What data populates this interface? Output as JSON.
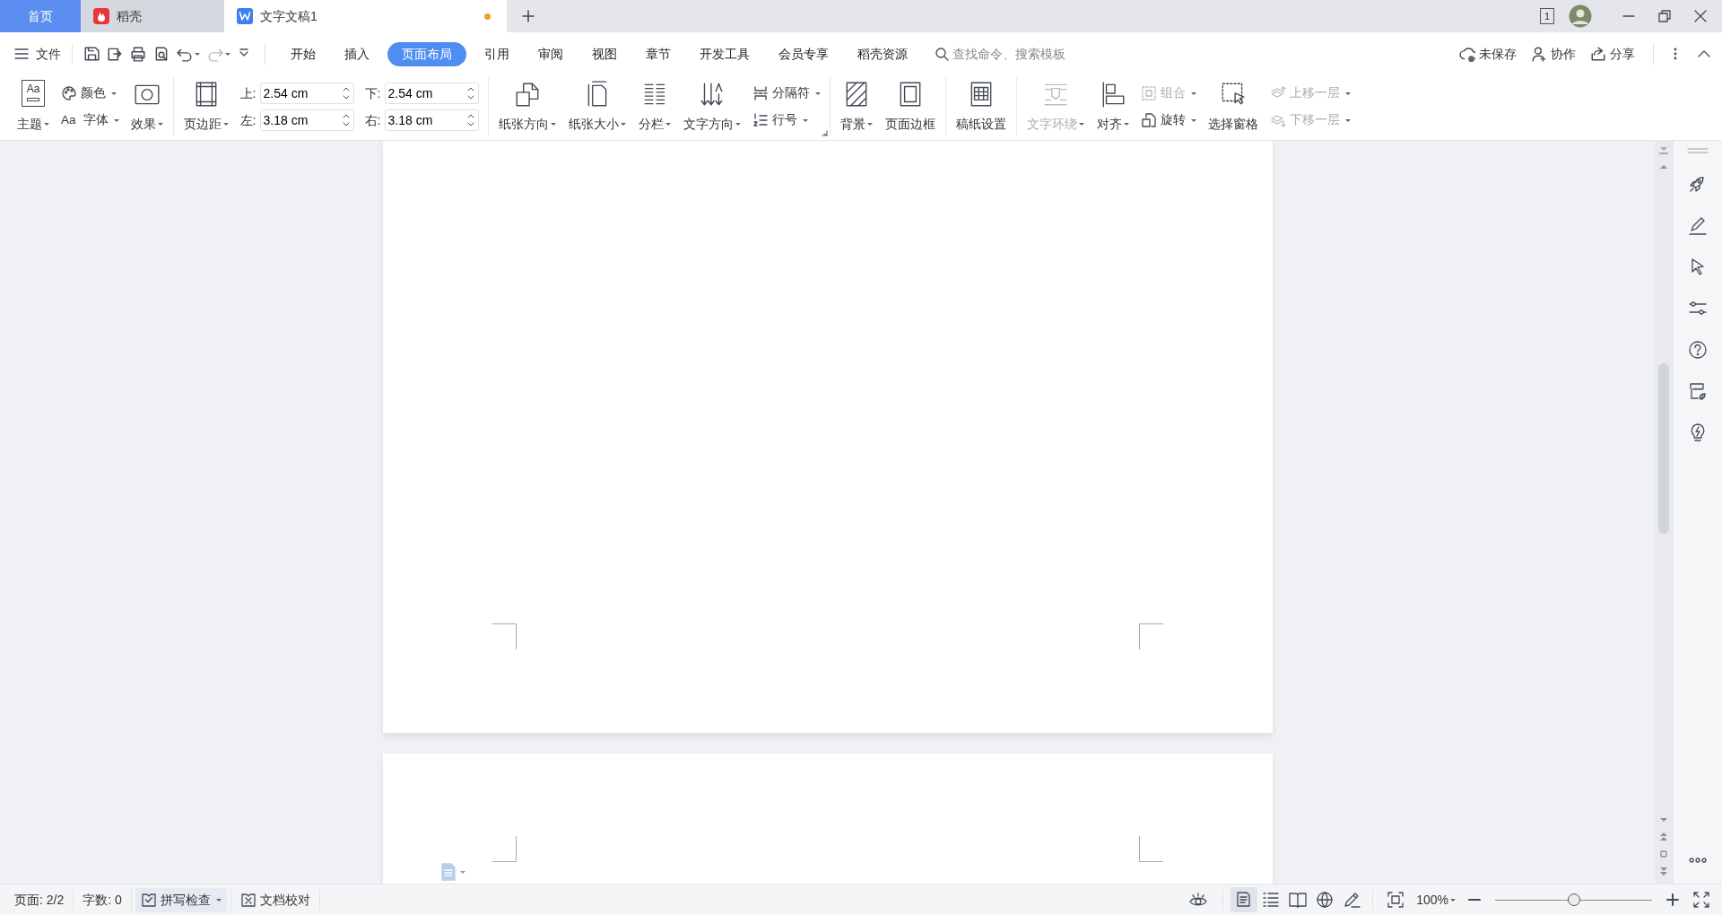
{
  "tabs": [
    {
      "kind": "home",
      "label": "首页",
      "selected": false
    },
    {
      "kind": "app",
      "label": "稻壳",
      "selected": false
    },
    {
      "kind": "document",
      "label": "文字文稿1",
      "selected": true,
      "unsaved": true
    }
  ],
  "title_bar": {
    "screen_badge": "1"
  },
  "menu": {
    "file": "文件",
    "tabs": [
      {
        "label": "开始",
        "selected": false
      },
      {
        "label": "插入",
        "selected": false
      },
      {
        "label": "页面布局",
        "selected": true
      },
      {
        "label": "引用",
        "selected": false
      },
      {
        "label": "审阅",
        "selected": false
      },
      {
        "label": "视图",
        "selected": false
      },
      {
        "label": "章节",
        "selected": false
      },
      {
        "label": "开发工具",
        "selected": false
      },
      {
        "label": "会员专享",
        "selected": false
      },
      {
        "label": "稻壳资源",
        "selected": false
      }
    ],
    "search": {
      "placeholder": "查找命令、搜索模板"
    },
    "actions": [
      {
        "label": "未保存"
      },
      {
        "label": "协作"
      },
      {
        "label": "分享"
      }
    ]
  },
  "ribbon": {
    "groups": [
      {
        "items": [
          {
            "kind": "large",
            "label": "主题",
            "icon_text": "Aa",
            "dropdown": true
          },
          {
            "kind": "stack",
            "items": [
              {
                "label": "颜色",
                "dropdown": true
              },
              {
                "label": "字体",
                "icon_text": "Aa",
                "dropdown": true
              }
            ]
          },
          {
            "kind": "large",
            "label": "效果",
            "dropdown": true
          }
        ]
      },
      {
        "items": [
          {
            "kind": "large",
            "label": "页边距",
            "dropdown": true
          },
          {
            "kind": "fields",
            "fields": [
              {
                "label": "上:",
                "value": "2.54 cm"
              },
              {
                "label": "左:",
                "value": "3.18 cm"
              }
            ]
          },
          {
            "kind": "fields",
            "fields": [
              {
                "label": "下:",
                "value": "2.54 cm"
              },
              {
                "label": "右:",
                "value": "3.18 cm"
              }
            ]
          }
        ]
      },
      {
        "launcher": true,
        "items": [
          {
            "kind": "large",
            "label": "纸张方向",
            "dropdown": true
          },
          {
            "kind": "large",
            "label": "纸张大小",
            "dropdown": true
          },
          {
            "kind": "large",
            "label": "分栏",
            "dropdown": true
          },
          {
            "kind": "large",
            "label": "文字方向",
            "dropdown": true
          },
          {
            "kind": "stack",
            "items": [
              {
                "label": "分隔符",
                "dropdown": true
              },
              {
                "label": "行号",
                "dropdown": true
              }
            ]
          }
        ]
      },
      {
        "items": [
          {
            "kind": "large",
            "label": "背景",
            "dropdown": true
          },
          {
            "kind": "large",
            "label": "页面边框"
          }
        ]
      },
      {
        "items": [
          {
            "kind": "large",
            "label": "稿纸设置"
          }
        ]
      },
      {
        "items": [
          {
            "kind": "large",
            "label": "文字环绕",
            "dropdown": true,
            "disabled": true
          },
          {
            "kind": "large",
            "label": "对齐",
            "dropdown": true
          },
          {
            "kind": "stack",
            "items": [
              {
                "label": "组合",
                "dropdown": true,
                "disabled": true
              },
              {
                "label": "旋转",
                "dropdown": true
              }
            ]
          },
          {
            "kind": "large",
            "label": "选择窗格"
          },
          {
            "kind": "stack",
            "items": [
              {
                "label": "上移一层",
                "dropdown": true,
                "disabled": true
              },
              {
                "label": "下移一层",
                "dropdown": true,
                "disabled": true
              }
            ]
          }
        ]
      }
    ]
  },
  "status_bar": {
    "items": [
      {
        "kind": "text",
        "label": "页面: 2/2"
      },
      {
        "kind": "text",
        "label": "字数: 0"
      },
      {
        "kind": "toggle",
        "label": "拼写检查",
        "checked": true,
        "dropdown": true
      },
      {
        "kind": "button",
        "label": "文档校对"
      }
    ],
    "views": [
      {
        "selected": true
      },
      {
        "selected": false
      },
      {
        "selected": false
      },
      {
        "selected": false
      },
      {
        "selected": false
      }
    ],
    "zoom": {
      "value": "100%",
      "level": 0.5
    }
  }
}
